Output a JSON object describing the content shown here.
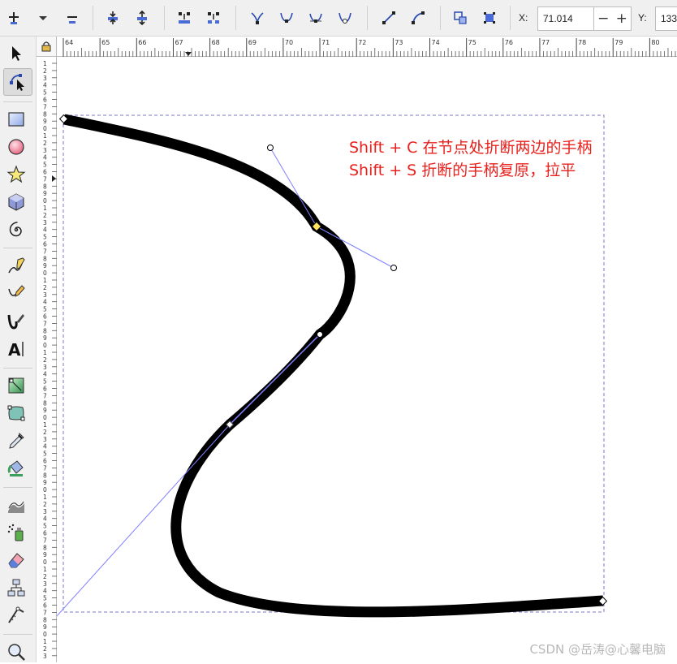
{
  "toolbar": {
    "x_label": "X:",
    "x_value": "71.014",
    "y_label": "Y:",
    "y_value": "133.",
    "buttons": [
      "insert-node-icon",
      "dropdown-arrow-icon",
      "delete-node-icon",
      "join-nodes-icon",
      "break-path-icon",
      "join-segment-icon",
      "delete-segment-icon",
      "node-cusp-icon",
      "node-smooth-icon",
      "node-symmetric-icon",
      "node-auto-icon",
      "segment-line-icon",
      "segment-curve-icon",
      "object-to-path-icon",
      "stroke-to-path-icon"
    ]
  },
  "toolbox": {
    "tools": [
      "selector-tool-icon",
      "node-tool-icon",
      "rectangle-tool-icon",
      "ellipse-tool-icon",
      "star-tool-icon",
      "box3d-tool-icon",
      "spiral-tool-icon",
      "pencil-tool-icon",
      "pen-tool-icon",
      "calligraphy-tool-icon",
      "text-tool-icon",
      "gradient-tool-icon",
      "mesh-tool-icon",
      "dropper-tool-icon",
      "paint-bucket-tool-icon",
      "tweak-tool-icon",
      "spray-tool-icon",
      "eraser-tool-icon",
      "connector-tool-icon",
      "measure-tool-icon",
      "zoom-tool-icon"
    ],
    "active_tool": "node-tool-icon"
  },
  "ruler": {
    "h_labels": [
      "64",
      "65",
      "66",
      "67",
      "68",
      "69",
      "70",
      "71",
      "72",
      "73",
      "74",
      "75",
      "76",
      "77",
      "78",
      "79",
      "80"
    ],
    "v_labels": [
      "1",
      "2",
      "3",
      "4",
      "5",
      "6",
      "7",
      "8",
      "9",
      "0",
      "1",
      "2",
      "3",
      "4",
      "5",
      "6",
      "7",
      "8",
      "9",
      "0",
      "1",
      "2",
      "3",
      "4",
      "5",
      "6",
      "7",
      "8",
      "9",
      "0",
      "1",
      "2",
      "3",
      "4",
      "5",
      "6",
      "7",
      "8",
      "9",
      "0",
      "1",
      "2",
      "3",
      "4",
      "5",
      "6",
      "7",
      "8",
      "9",
      "0",
      "1",
      "2",
      "3",
      "4",
      "5",
      "6",
      "7",
      "8",
      "9",
      "0",
      "1",
      "2",
      "3",
      "4",
      "5",
      "6",
      "7",
      "8",
      "9",
      "0",
      "1",
      "2",
      "3",
      "4",
      "5",
      "6",
      "7",
      "8",
      "9",
      "0",
      "1",
      "2",
      "3",
      "4",
      "5",
      "6",
      "7",
      "8",
      "9",
      "0"
    ]
  },
  "annotation": {
    "line1": "Shift + C 在节点处折断两边的手柄",
    "line2": "Shift + S 折断的手柄复原，拉平",
    "color": "#e8211d"
  },
  "watermark": "CSDN @岳涛@心馨电脑",
  "colors": {
    "path_stroke": "#000000",
    "handle_line": "#8080ff",
    "bbox_dash": "#7777cc",
    "selected_node": "#ffe45c"
  }
}
